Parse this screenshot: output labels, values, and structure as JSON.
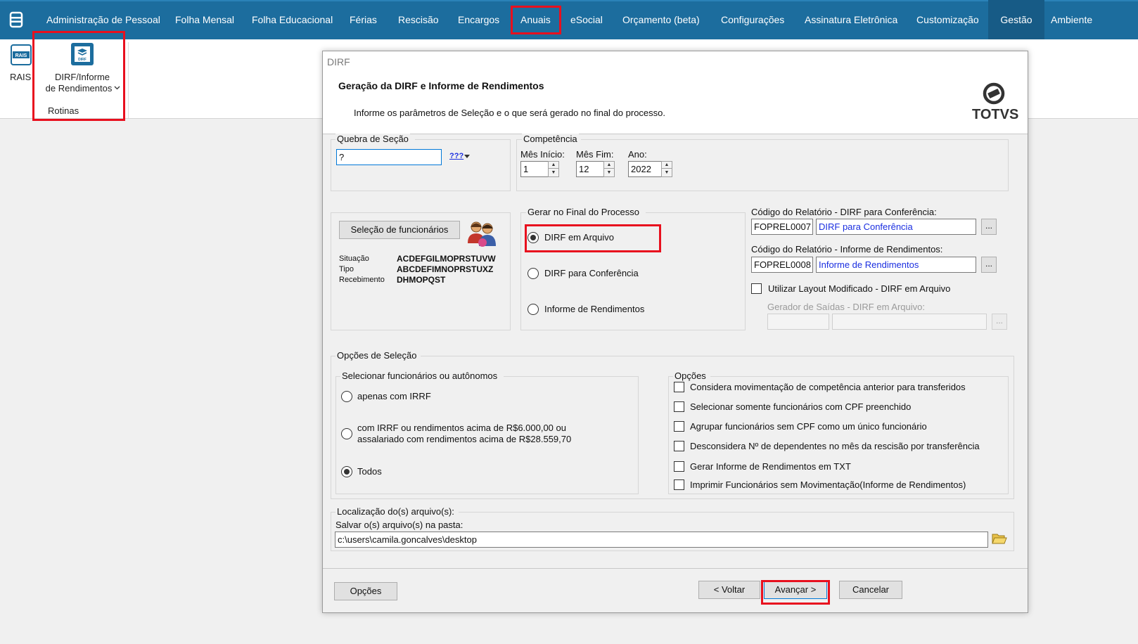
{
  "menubar": {
    "items": [
      "Administração de Pessoal",
      "Folha Mensal",
      "Folha Educacional",
      "Férias",
      "Rescisão",
      "Encargos",
      "Anuais",
      "eSocial",
      "Orçamento (beta)",
      "Configurações",
      "Assinatura Eletrônica",
      "Customização",
      "Gestão",
      "Ambiente"
    ],
    "accent_color": "#1c6d9e",
    "highlight_color": "#e8101e"
  },
  "ribbon": {
    "rais_label": "RAIS",
    "rais_icon_text": "RAIS",
    "dirf_label_line1": "DIRF/Informe",
    "dirf_label_line2": "de Rendimentos",
    "dirf_icon_text": "DIRF",
    "group_label": "Rotinas"
  },
  "dialog": {
    "window_title": "DIRF",
    "title": "Geração da DIRF e Informe de Rendimentos",
    "subtitle": "Informe os parâmetros de Seleção e o que será gerado no final do processo.",
    "brand": "TOTVS",
    "quebra": {
      "title": "Quebra de Seção",
      "value": "?",
      "lookup_icon_text": "???"
    },
    "competencia": {
      "title": "Competência",
      "mes_inicio_label": "Mês Início:",
      "mes_inicio_value": "1",
      "mes_fim_label": "Mês Fim:",
      "mes_fim_value": "12",
      "ano_label": "Ano:",
      "ano_value": "2022"
    },
    "selecao_func": {
      "button": "Seleção de funcionários",
      "situacao_label": "Situação",
      "situacao_value": "ACDEFGILMOPRSTUVW",
      "tipo_label": "Tipo",
      "tipo_value": "ABCDEFIMNOPRSTUXZ",
      "recebimento_label": "Recebimento",
      "recebimento_value": "DHMOPQST"
    },
    "gerar": {
      "title": "Gerar no Final do Processo",
      "options": [
        "DIRF em Arquivo",
        "DIRF para Conferência",
        "Informe de Rendimentos"
      ],
      "selected": 0
    },
    "relatorios": {
      "conf_label": "Código do Relatório - DIRF para Conferência:",
      "conf_code": "FOPREL0007",
      "conf_name": "DIRF para Conferência",
      "inf_label": "Código do Relatório - Informe de Rendimentos:",
      "inf_code": "FOPREL0008",
      "inf_name": "Informe de Rendimentos",
      "layout_label": "Utilizar Layout Modificado - DIRF em Arquivo",
      "gerador_label": "Gerador de Saídas - DIRF em Arquivo:",
      "browse": "..."
    },
    "opcoes_selecao": {
      "title": "Opções de Seleção",
      "sub_title": "Selecionar funcionários ou autônomos",
      "opt1": "apenas com IRRF",
      "opt2_line1": "com IRRF ou rendimentos acima de R$6.000,00 ou",
      "opt2_line2": "assalariado com rendimentos acima de R$28.559,70",
      "opt3": "Todos",
      "selected": 2
    },
    "opcoes": {
      "title": "Opções",
      "items": [
        "Considera movimentação de competência anterior para transferidos",
        "Selecionar somente funcionários com CPF preenchido",
        "Agrupar funcionários sem CPF como um único funcionário",
        "Desconsidera Nº de dependentes no mês da rescisão por transferência",
        "Gerar Informe de Rendimentos em TXT",
        "Imprimir Funcionários sem Movimentação(Informe de Rendimentos)"
      ]
    },
    "localizacao": {
      "title": "Localização do(s) arquivo(s):",
      "label": "Salvar o(s) arquivo(s) na pasta:",
      "value": "c:\\users\\camila.goncalves\\desktop"
    },
    "footer": {
      "opcoes": "Opções",
      "voltar": "< Voltar",
      "avancar": "Avançar >",
      "cancelar": "Cancelar"
    }
  }
}
